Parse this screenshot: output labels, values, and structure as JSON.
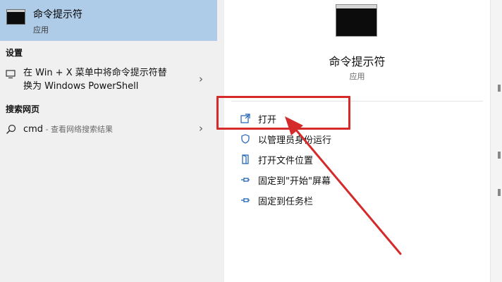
{
  "best_match": {
    "title": "命令提示符",
    "subtitle": "应用",
    "icon": "command-prompt-icon"
  },
  "settings_section": {
    "heading": "设置",
    "item": {
      "line1": "在 Win + X 菜单中将命令提示符替",
      "line2": "换为 Windows PowerShell",
      "icon": "monitor-icon"
    }
  },
  "web_section": {
    "heading": "搜索网页",
    "item": {
      "query": "cmd",
      "hint": " - 查看网络搜索结果",
      "icon": "search-icon"
    }
  },
  "preview": {
    "title": "命令提示符",
    "subtitle": "应用",
    "actions": [
      {
        "label": "打开",
        "icon": "open-icon"
      },
      {
        "label": "以管理员身份运行",
        "icon": "shield-icon"
      },
      {
        "label": "打开文件位置",
        "icon": "folder-icon"
      },
      {
        "label": "固定到\"开始\"屏幕",
        "icon": "pin-icon"
      },
      {
        "label": "固定到任务栏",
        "icon": "pin-icon"
      }
    ]
  },
  "annotation": {
    "highlight_color": "#d42a2a"
  }
}
